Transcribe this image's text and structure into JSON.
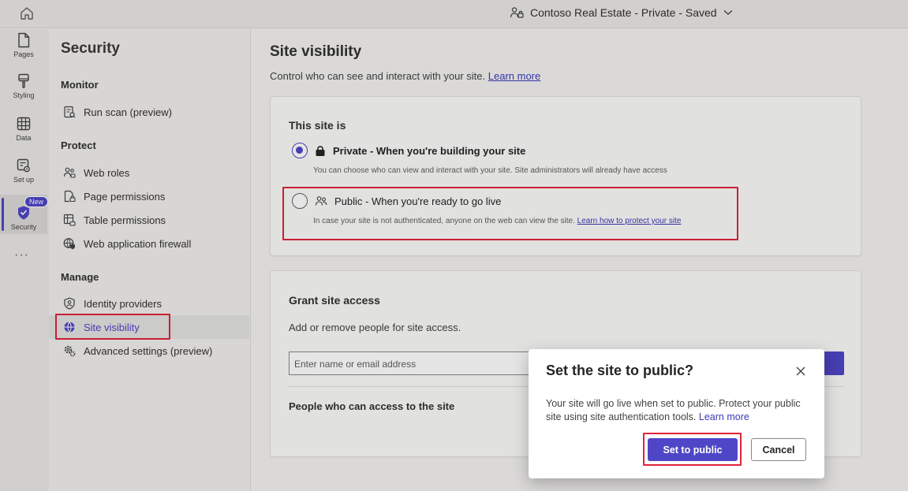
{
  "topbar": {
    "site_title": "Contoso Real Estate - Private - Saved"
  },
  "rail": {
    "items": [
      {
        "label": "Pages",
        "icon": "document-icon"
      },
      {
        "label": "Styling",
        "icon": "paintbrush-icon"
      },
      {
        "label": "Data",
        "icon": "table-icon"
      },
      {
        "label": "Set up",
        "icon": "setup-icon"
      },
      {
        "label": "Security",
        "icon": "shield-icon",
        "badge": "New",
        "active": true
      }
    ],
    "more": "···"
  },
  "nav": {
    "title": "Security",
    "sections": [
      {
        "title": "Monitor",
        "items": [
          {
            "label": "Run scan (preview)",
            "icon": "scan-icon"
          }
        ]
      },
      {
        "title": "Protect",
        "items": [
          {
            "label": "Web roles",
            "icon": "people-icon"
          },
          {
            "label": "Page permissions",
            "icon": "page-lock-icon"
          },
          {
            "label": "Table permissions",
            "icon": "table-lock-icon"
          },
          {
            "label": "Web application firewall",
            "icon": "globe-shield-icon"
          }
        ]
      },
      {
        "title": "Manage",
        "items": [
          {
            "label": "Identity providers",
            "icon": "identity-icon"
          },
          {
            "label": "Site visibility",
            "icon": "globe-icon",
            "selected": true
          },
          {
            "label": "Advanced settings (preview)",
            "icon": "settings-icon"
          }
        ]
      }
    ]
  },
  "main": {
    "title": "Site visibility",
    "subtitle": "Control who can see and interact with your site.",
    "subtitle_link": "Learn more",
    "visibility_card": {
      "heading": "This site is",
      "options": [
        {
          "label": "Private - When you're building your site",
          "desc": "You can choose who can view and interact with your site. Site administrators will already have access",
          "checked": true
        },
        {
          "label": "Public - When you're ready to go live",
          "desc": "In case your site is not authenticated, anyone on the web can view the site.",
          "desc_link": "Learn how to protect your site",
          "checked": false
        }
      ]
    },
    "grant_card": {
      "heading": "Grant site access",
      "description": "Add or remove people for site access.",
      "input_placeholder": "Enter name or email address",
      "people_heading": "People who can access to the site"
    }
  },
  "dialog": {
    "title": "Set the site to public?",
    "body": "Your site will go live when set to public. Protect your public site using site authentication tools.",
    "body_link": "Learn more",
    "primary_button": "Set to public",
    "secondary_button": "Cancel"
  },
  "colors": {
    "accent": "#4f46c7",
    "highlight_border": "#e0243a"
  }
}
